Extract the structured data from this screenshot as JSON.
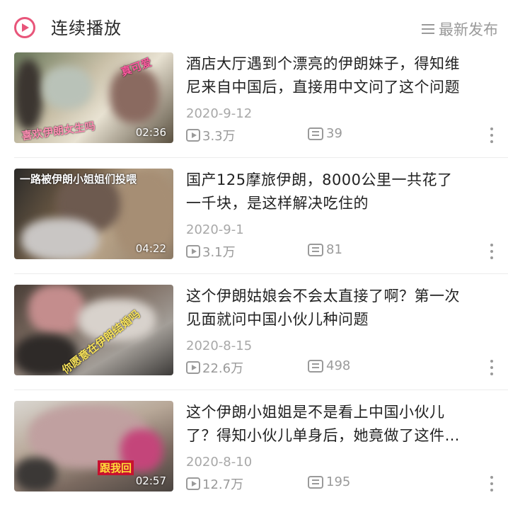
{
  "header": {
    "title": "连续播放",
    "sort_label": "最新发布",
    "accent_color": "#e8557a"
  },
  "videos": [
    {
      "title_line1": "酒店大厅遇到个漂亮的伊朗妹子，得知维",
      "title_line2": "尼来自中国后，直接用中文问了这个问题",
      "date": "2020-9-12",
      "views": "3.3万",
      "comments": "39",
      "duration": "02:36",
      "thumb_captions": [
        "喜欢伊朗女生吗",
        "真可爱"
      ]
    },
    {
      "title_line1": "国产125摩旅伊朗，8000公里一共花了",
      "title_line2": "一千块，是这样解决吃住的",
      "date": "2020-9-1",
      "views": "3.1万",
      "comments": "81",
      "duration": "04:22",
      "thumb_captions": [
        "一路被伊朗小姐姐们投喂"
      ]
    },
    {
      "title_line1": "这个伊朗姑娘会不会太直接了啊？第一次",
      "title_line2": "见面就问中国小伙儿种问题",
      "date": "2020-8-15",
      "views": "22.6万",
      "comments": "498",
      "duration": "",
      "thumb_captions": [
        "你愿意在伊朗结婚吗"
      ]
    },
    {
      "title_line1": "这个伊朗小姐姐是不是看上中国小伙儿",
      "title_line2": "了？得知小伙儿单身后，她竟做了这件…",
      "date": "2020-8-10",
      "views": "12.7万",
      "comments": "195",
      "duration": "02:57",
      "thumb_captions": [
        "跟我回"
      ]
    }
  ]
}
